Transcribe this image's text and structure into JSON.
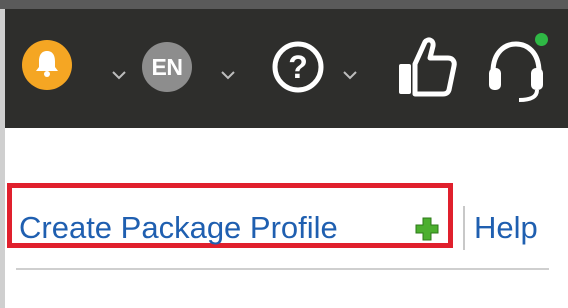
{
  "header": {
    "notifications": {
      "icon": "bell-icon",
      "color": "#f5a623"
    },
    "language": {
      "label": "EN"
    },
    "help": {
      "icon": "question-circle-icon"
    },
    "feedback": {
      "icon": "thumbs-up-icon"
    },
    "support": {
      "icon": "headset-icon",
      "status_color": "#2fb845"
    }
  },
  "toolbar": {
    "create_label": "Create Package Profile",
    "create_icon": "plus-icon",
    "help_label": "Help"
  },
  "colors": {
    "topbar": "#2e2e2c",
    "link": "#1f5fb0",
    "highlight": "#e0202d"
  }
}
